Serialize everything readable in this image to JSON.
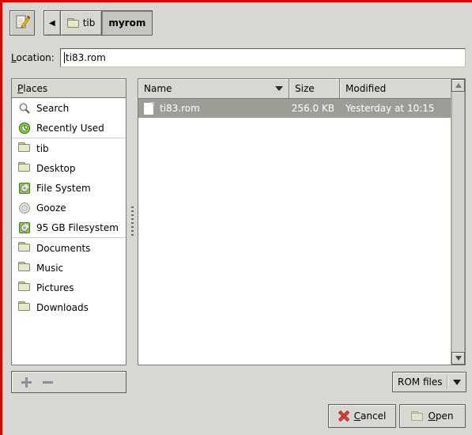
{
  "window": {
    "accent_border": "#e00000",
    "background": "#d8d8d3"
  },
  "toolbar": {
    "type_name_button_icon": "pencil-document-icon",
    "back_arrow": "◀",
    "breadcrumbs": [
      {
        "label": "tib",
        "active": false
      },
      {
        "label": "myrom",
        "active": true
      }
    ]
  },
  "location": {
    "label_prefix": "L",
    "label_rest": "ocation:",
    "value": "ti83.rom"
  },
  "places": {
    "header_prefix": "P",
    "header_rest": "laces",
    "items": [
      {
        "label": "Search",
        "icon": "search-icon",
        "separator_before": false
      },
      {
        "label": "Recently Used",
        "icon": "recent-clock-icon",
        "separator_before": false
      },
      {
        "label": "tib",
        "icon": "folder-icon",
        "separator_before": true
      },
      {
        "label": "Desktop",
        "icon": "folder-icon",
        "separator_before": false
      },
      {
        "label": "File System",
        "icon": "harddisk-icon",
        "separator_before": false
      },
      {
        "label": "Gooze",
        "icon": "disc-icon",
        "separator_before": false
      },
      {
        "label": "95 GB Filesystem",
        "icon": "harddisk-icon",
        "separator_before": false
      },
      {
        "label": "Documents",
        "icon": "folder-icon",
        "separator_before": true
      },
      {
        "label": "Music",
        "icon": "folder-icon",
        "separator_before": false
      },
      {
        "label": "Pictures",
        "icon": "folder-icon",
        "separator_before": false
      },
      {
        "label": "Downloads",
        "icon": "folder-icon",
        "separator_before": false
      }
    ],
    "add_button_icon": "plus-icon",
    "remove_button_icon": "minus-icon"
  },
  "filelist": {
    "columns": {
      "name": "Name",
      "size": "Size",
      "modified": "Modified"
    },
    "sort_column": "Name",
    "sort_direction": "descending",
    "rows": [
      {
        "name": "ti83.rom",
        "size": "256.0 KB",
        "modified": "Yesterday at 10:15",
        "selected": true,
        "icon": "file-icon"
      }
    ],
    "selection_color": "#9d9d96"
  },
  "filter": {
    "label": "ROM files"
  },
  "actions": {
    "cancel": {
      "prefix": "C",
      "rest": "ancel",
      "lead": "",
      "icon": "red-x-icon"
    },
    "open": {
      "prefix": "O",
      "rest": "pen",
      "lead": "",
      "icon": "folder-icon"
    }
  },
  "scrollbar": {
    "up_arrow": "▲",
    "down_arrow": "▼"
  }
}
